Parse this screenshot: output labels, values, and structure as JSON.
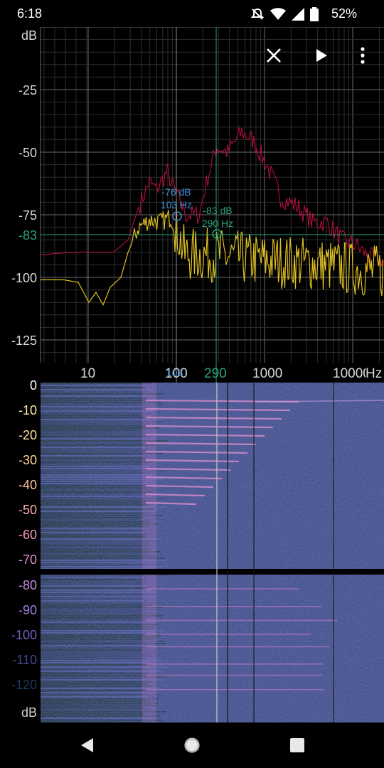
{
  "status": {
    "time": "6:18",
    "battery": "52%"
  },
  "toolbar": {
    "close_icon": "close-icon",
    "play_icon": "play-icon",
    "menu_icon": "more-vert-icon"
  },
  "spectrum": {
    "y_unit": "dB",
    "y_ticks": [
      "-25",
      "-50",
      "-75",
      "-83",
      "-100",
      "-125"
    ],
    "x_ticks": [
      "10",
      "100",
      "103",
      "290",
      "1000",
      "10000",
      "Hz"
    ],
    "cursor1": {
      "db": "-76 dB",
      "hz": "103 Hz",
      "color": "#3f8fd8"
    },
    "cursor2": {
      "db": "-83 dB",
      "hz": "290 Hz",
      "color": "#2aa37a"
    },
    "series_colors": {
      "peak": "#c01040",
      "live": "#e0c020"
    }
  },
  "spectrogram": {
    "labels": [
      "0",
      "-10",
      "-20",
      "-30",
      "-40",
      "-50",
      "-60",
      "-70",
      "-80",
      "-90",
      "-100",
      "-110",
      "-120",
      "dB"
    ],
    "label_colors": [
      "#ffffff",
      "#ffe9b0",
      "#ffe0a0",
      "#ffd090",
      "#ffc2a0",
      "#ffaab0",
      "#f09ac0",
      "#e090d0",
      "#c090e0",
      "#9a80e0",
      "#7060c0",
      "#404890",
      "#203860",
      "#d0d0d0"
    ]
  },
  "navbar": {
    "back_icon": "back-icon",
    "home_icon": "home-icon",
    "recents_icon": "recents-icon"
  }
}
